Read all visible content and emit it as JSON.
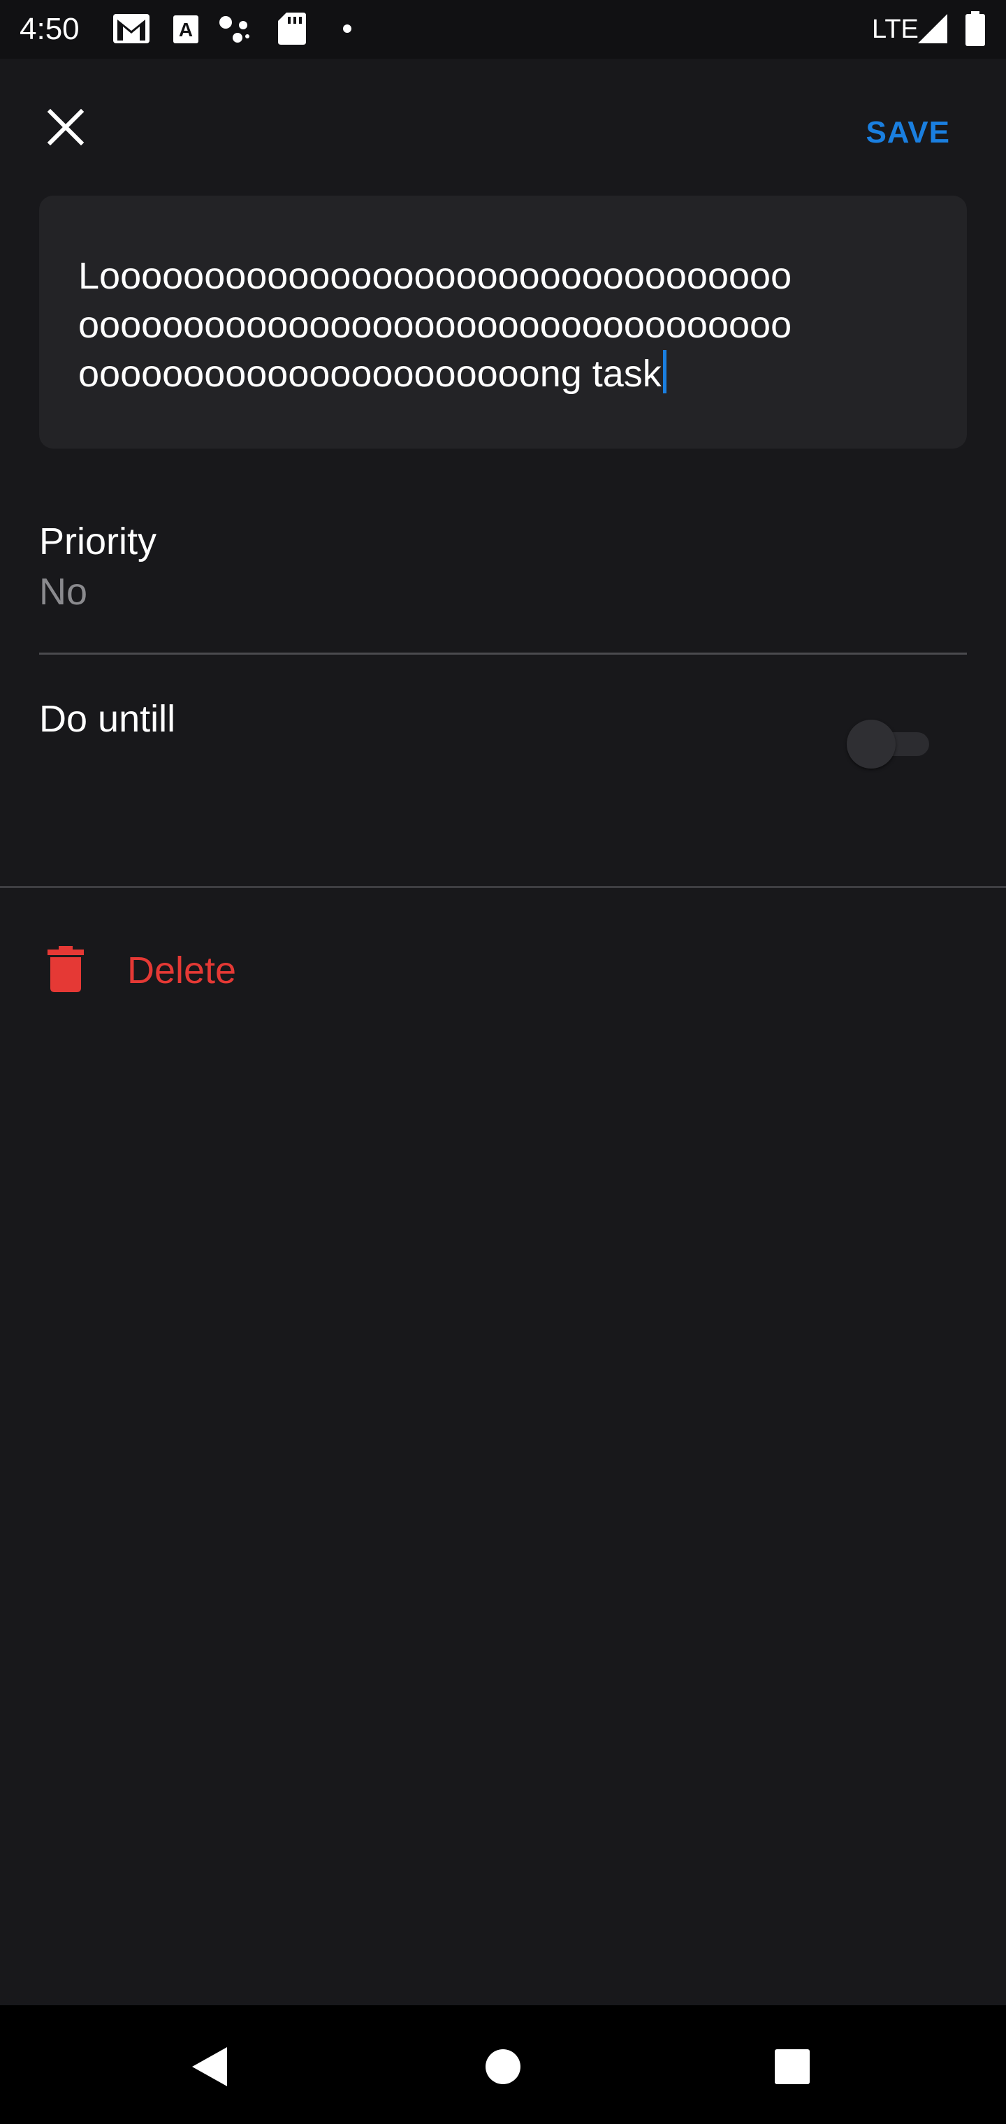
{
  "status_bar": {
    "time": "4:50",
    "network": "LTE",
    "icons": [
      "gmail-icon",
      "a-icon",
      "assistant-icon",
      "sd-card-icon",
      "dot-icon",
      "signal-icon",
      "battery-icon"
    ]
  },
  "toolbar": {
    "close_icon": "close-icon",
    "save_label": "SAVE"
  },
  "task": {
    "lines": [
      "Looooooooooooooooooooooooooooooooo",
      "oooooooooooooooooooooooooooooooooo",
      "oooooooooooooooooooooong task"
    ]
  },
  "priority": {
    "label": "Priority",
    "value": "No"
  },
  "do_untill": {
    "label": "Do untill",
    "enabled": false
  },
  "delete": {
    "label": "Delete",
    "icon": "trash-icon"
  },
  "colors": {
    "background": "#18181b",
    "accent": "#1a7fe0",
    "danger": "#e53935",
    "secondary_text": "#8a8a8e"
  },
  "nav": {
    "icons": [
      "back-icon",
      "home-icon",
      "recents-icon"
    ]
  }
}
